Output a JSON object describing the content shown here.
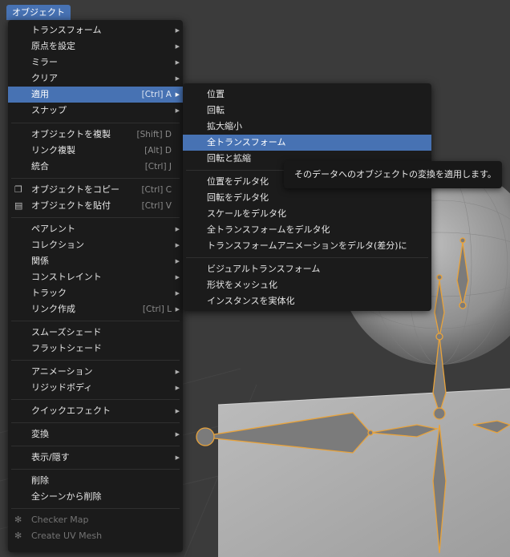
{
  "header": {
    "menu_label": "オブジェクト"
  },
  "main_menu": {
    "transform": "トランスフォーム",
    "set_origin": "原点を設定",
    "mirror": "ミラー",
    "clear": "クリア",
    "apply": "適用",
    "apply_shortcut": "[Ctrl] A",
    "snap": "スナップ",
    "duplicate": "オブジェクトを複製",
    "duplicate_shortcut": "[Shift] D",
    "link_duplicate": "リンク複製",
    "link_duplicate_shortcut": "[Alt] D",
    "join": "統合",
    "join_shortcut": "[Ctrl] J",
    "copy": "オブジェクトをコピー",
    "copy_shortcut": "[Ctrl] C",
    "paste": "オブジェクトを貼付",
    "paste_shortcut": "[Ctrl] V",
    "parent": "ペアレント",
    "collection": "コレクション",
    "relations": "関係",
    "constraint": "コンストレイント",
    "track": "トラック",
    "link_make": "リンク作成",
    "link_make_shortcut": "[Ctrl] L",
    "shade_smooth": "スムーズシェード",
    "shade_flat": "フラットシェード",
    "animation": "アニメーション",
    "rigid_body": "リジッドボディ",
    "quick_effects": "クイックエフェクト",
    "convert": "変換",
    "show_hide": "表示/隠す",
    "delete": "削除",
    "delete_global": "全シーンから削除",
    "checker_map": "Checker Map",
    "create_uv_mesh": "Create UV Mesh"
  },
  "sub_menu": {
    "location": "位置",
    "rotation": "回転",
    "scale": "拡大縮小",
    "all_transforms": "全トランスフォーム",
    "rotation_scale": "回転と拡縮",
    "location_to_deltas": "位置をデルタ化",
    "rotation_to_deltas": "回転をデルタ化",
    "scale_to_deltas": "スケールをデルタ化",
    "all_to_deltas": "全トランスフォームをデルタ化",
    "anim_to_deltas": "トランスフォームアニメーションをデルタ(差分)に",
    "visual_transform": "ビジュアルトランスフォーム",
    "visual_geometry": "形状をメッシュ化",
    "make_instances_real": "インスタンスを実体化"
  },
  "tooltip": {
    "text": "そのデータへのオブジェクトの変換を適用します。"
  },
  "colors": {
    "accent": "#4772b3",
    "menu_bg": "#1b1b1b",
    "bone": "#e8a33c"
  }
}
